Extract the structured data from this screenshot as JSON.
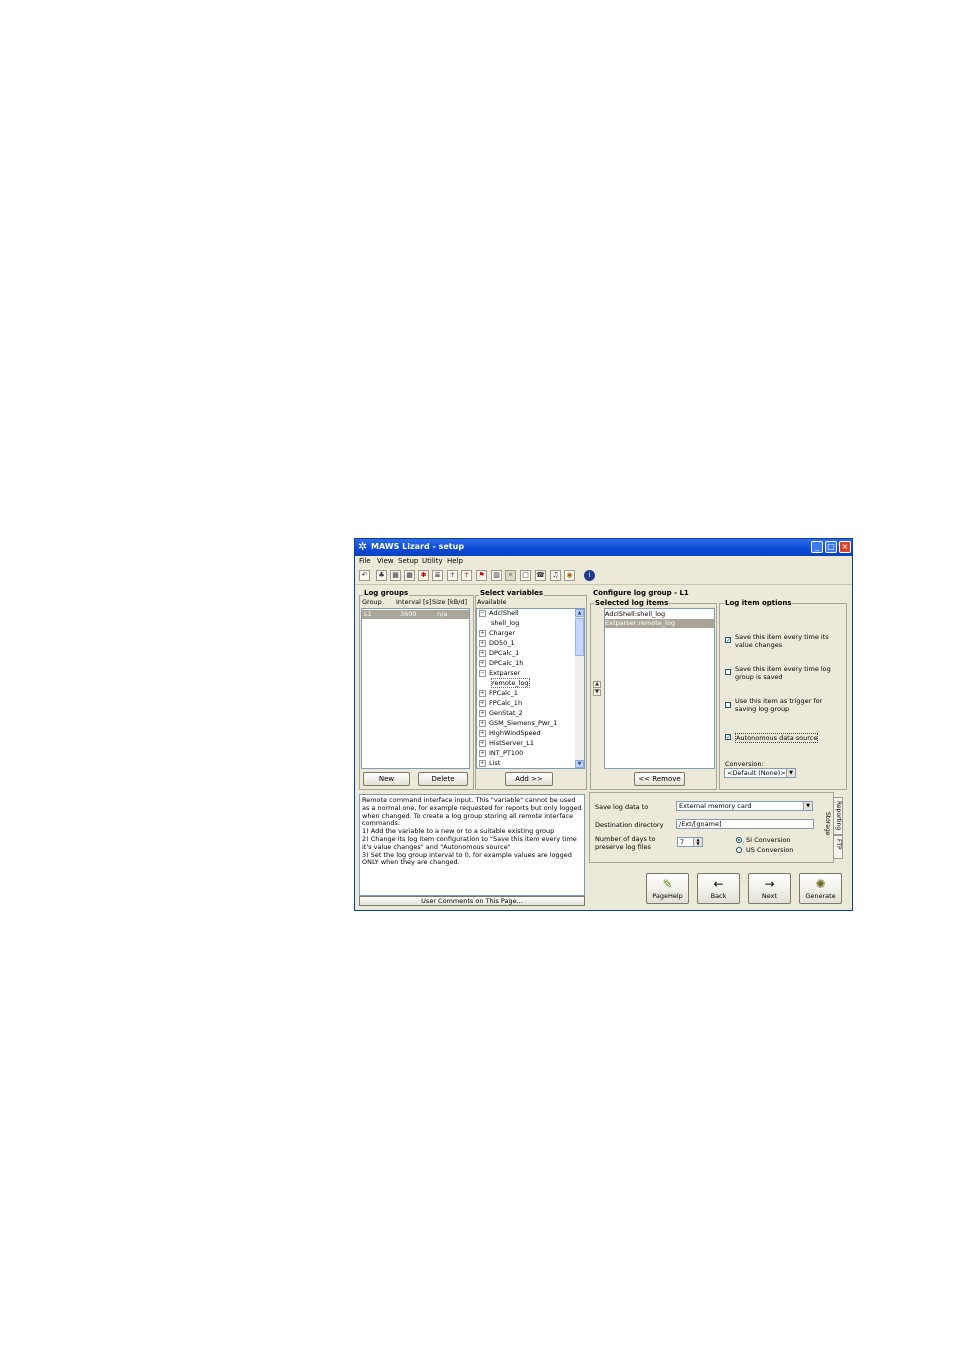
{
  "window": {
    "title": "MAWS Lizard - setup",
    "title_icon": "lizard-star-icon",
    "controls": [
      "_",
      "□",
      "×"
    ]
  },
  "menu": [
    "File",
    "View",
    "Setup",
    "Utility",
    "Help"
  ],
  "toolbar_icons": [
    "undo-icon",
    "station-icon",
    "def-icon",
    "def2-icon",
    "sensor-icon",
    "list-icon",
    "person-icon",
    "person2-icon",
    "flag-icon",
    "grid-icon",
    "log-icon",
    "page-icon",
    "comm-icon",
    "bell-icon",
    "globe-icon",
    "info-icon"
  ],
  "log_groups": {
    "title": "Log groups",
    "headers": {
      "group": "Group",
      "interval": "Interval [s]",
      "size": "Size [kB/d]"
    },
    "rows": [
      {
        "group": "L1",
        "interval": "3600",
        "size": "n/a"
      }
    ],
    "new_label": "New",
    "delete_label": "Delete"
  },
  "select_variables": {
    "title": "Select variables",
    "available_label": "Available",
    "tree": [
      {
        "label": "AdclShell",
        "state": "−",
        "indent": 0
      },
      {
        "label": "shell_log",
        "state": "",
        "indent": 1
      },
      {
        "label": "Charger",
        "state": "+",
        "indent": 0
      },
      {
        "label": "DD50_1",
        "state": "+",
        "indent": 0
      },
      {
        "label": "DPCalc_1",
        "state": "+",
        "indent": 0
      },
      {
        "label": "DPCalc_1h",
        "state": "+",
        "indent": 0
      },
      {
        "label": "Extparser",
        "state": "−",
        "indent": 0
      },
      {
        "label": "remote_log",
        "state": "",
        "indent": 1
      },
      {
        "label": "FPCalc_1",
        "state": "+",
        "indent": 0
      },
      {
        "label": "FPCalc_1h",
        "state": "+",
        "indent": 0
      },
      {
        "label": "GenStat_2",
        "state": "+",
        "indent": 0
      },
      {
        "label": "GSM_Siemens_Pwr_1",
        "state": "+",
        "indent": 0
      },
      {
        "label": "HighWindSpeed",
        "state": "+",
        "indent": 0
      },
      {
        "label": "HistServer_L1",
        "state": "+",
        "indent": 0
      },
      {
        "label": "INT_PT100",
        "state": "+",
        "indent": 0
      },
      {
        "label": "List",
        "state": "+",
        "indent": 0
      }
    ],
    "add_label": "Add >>"
  },
  "configure": {
    "title": "Configure log group - L1",
    "selected_title": "Selected log items",
    "selected_items": [
      "AdclShell:shell_log",
      "Extparser:remote_log"
    ],
    "remove_label": "<< Remove"
  },
  "log_item_options": {
    "title": "Log item options",
    "options": [
      {
        "label": "Save this item every time its value changes",
        "checked": true
      },
      {
        "label": "Save this item every time log group is saved",
        "checked": false
      },
      {
        "label": "Use this item as trigger for saving log group",
        "checked": false
      },
      {
        "label": "Autonomous data source",
        "checked": true
      }
    ],
    "conversion_label": "Conversion:",
    "conversion_value": "<Default (None)>"
  },
  "comments": {
    "text": "Remote command interface input. This \"variable\" cannot be used as a normal one, for example requested for reports but only logged when changed. To create a log group storing all remote interface commands:\n1) Add the variable to a new or to a suitable existing group\n2) Change its log item configuration to \"Save this item every time it's value changes\" and \"Autonomous source\"\n3) Set the log group interval to 0, for example values are logged ONLY when they are changed.",
    "footer": "User Comments on This Page..."
  },
  "storage": {
    "save_label": "Save log data to",
    "save_value": "External memory card",
    "dest_label": "Destination directory",
    "dest_value": "/Ext/[gname]",
    "days_label": "Number of days to preserve log files",
    "days_value": "7",
    "si_label": "SI Conversion",
    "us_label": "US Conversion",
    "tabs": [
      "Reporting",
      "Storage",
      "FTP"
    ]
  },
  "buttons": {
    "pagehelp": "PageHelp",
    "back": "Back",
    "next": "Next",
    "generate": "Generate"
  }
}
